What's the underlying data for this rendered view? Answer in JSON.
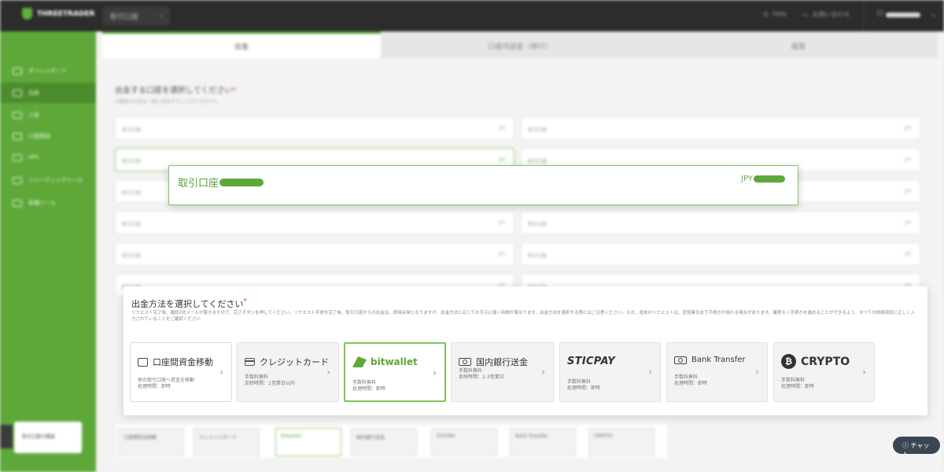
{
  "topbar": {
    "logo": "THREETRADER",
    "account_select": "取引口座",
    "link1": "Help",
    "link2": "お問い合わせ",
    "user_icon": "user-icon"
  },
  "sidebar": {
    "items": [
      {
        "label": "ダッシュボード"
      },
      {
        "label": "出金"
      },
      {
        "label": "入金"
      },
      {
        "label": "口座開設"
      },
      {
        "label": "VPS"
      },
      {
        "label": "トレーディングツール"
      },
      {
        "label": "各種ツール"
      }
    ],
    "card": "取引口座の開設"
  },
  "tabs": [
    {
      "label": "出金"
    },
    {
      "label": "口座内送金（移行）"
    },
    {
      "label": "履歴"
    }
  ],
  "account_section": {
    "title": "出金する口座を選択してください",
    "required": "*",
    "sub": "※複数の口座を一度に出金することはできません"
  },
  "bg_accounts": [
    {
      "l": "取引口座",
      "r": "JPY"
    },
    {
      "l": "取引口座",
      "r": "JPY"
    },
    {
      "l": "取引口座",
      "r": "JPY"
    },
    {
      "l": "取引口座",
      "r": "JPY"
    },
    {
      "l": "取引口座",
      "r": "JPY"
    },
    {
      "l": "取引口座",
      "r": "JPY"
    },
    {
      "l": "取引口座",
      "r": "JPY"
    },
    {
      "l": "取引口座",
      "r": "JPY"
    },
    {
      "l": "取引口座",
      "r": "JPY"
    },
    {
      "l": "取引口座",
      "r": "JPY"
    },
    {
      "l": "取引口座",
      "r": "JPY"
    },
    {
      "l": "取引口座",
      "r": "JPY"
    }
  ],
  "selected_account": {
    "name": "取引口座",
    "currency": "JPY"
  },
  "method_section": {
    "title": "出金方法を選択してください",
    "required": "*",
    "description": "リクエスト完了後、確認のEメールが届きますので、完了ボタンを押してください。リクエスト手続き完了後、取引口座からの出金は、即時反映となりますが、出金方法に応じてお手元に届く時間が異なります。出金方法を選択する際にはご注意ください。なお、週末のリクエストは、翌営業日まで手続きが遅れる場合があります。確実なく手続きを進めることができるよう、すべての詳細項目に正しく入力されていることをご確認ください"
  },
  "methods": [
    {
      "id": "internal",
      "name": "口座間資金移動",
      "line1": "他の取引口座へ資金を移動",
      "line2": "処理時間：即時",
      "icon": "transfer-icon"
    },
    {
      "id": "card",
      "name": "クレジットカード",
      "line1": "手数料無料",
      "line2": "反映時間：1営業日以内",
      "icon": "credit-card-icon"
    },
    {
      "id": "bitwallet",
      "name": "bitwallet",
      "line1": "手数料無料",
      "line2": "処理時間：即時",
      "icon": "bitwallet-logo"
    },
    {
      "id": "domestic",
      "name": "国内銀行送金",
      "line1": "手数料無料",
      "line2": "反映時間：2-3営業日",
      "icon": "bank-bill-icon"
    },
    {
      "id": "sticpay",
      "name": "STICPAY",
      "line1": "手数料無料",
      "line2": "処理時間：即時",
      "icon": "sticpay-logo"
    },
    {
      "id": "bank",
      "name": "Bank Transfer",
      "line1": "手数料無料",
      "line2": "処理時間：即時",
      "icon": "bank-bill-icon"
    },
    {
      "id": "crypto",
      "name": "CRYPTO",
      "line1": "手数料無料",
      "line2": "処理時間：即時",
      "icon": "bitcoin-icon"
    }
  ],
  "help_button": "チャット",
  "colors": {
    "brand_green": "#5ea839",
    "selected_border": "#7ec65b",
    "topbar": "#2c2c2c"
  }
}
